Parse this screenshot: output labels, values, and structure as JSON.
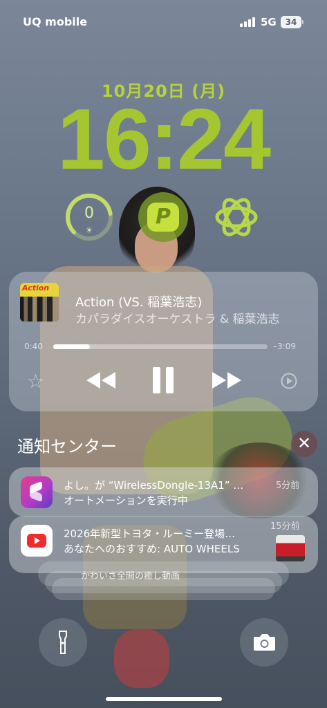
{
  "status_bar": {
    "carrier": "UQ mobile",
    "network": "5G",
    "battery": "34"
  },
  "lock": {
    "date": "10月20日 (月)",
    "time": "16:24"
  },
  "widgets": {
    "ring_value": "0",
    "ring_level": 0.8,
    "sun_icon": "☀",
    "paypay_glyph": "P"
  },
  "now_playing": {
    "title": "Action (VS. 稲葉浩志)",
    "artist": "カパラダイスオーケストラ & 稲葉浩志",
    "art_text": "Action",
    "elapsed": "0:40",
    "remaining": "–3:09",
    "progress": 0.17,
    "favorite_icon": "☆"
  },
  "notification_center": {
    "title": "通知センター",
    "close_icon": "✕",
    "notifications": [
      {
        "app": "shortcuts",
        "title": "よし。が “WirelessDongle-13A1” …",
        "body": "オートメーションを実行中",
        "time": "5分前"
      },
      {
        "app": "youtube",
        "title": "2026年新型トヨタ・ルーミー登場…",
        "body": "あなたへのおすすめ: AUTO WHEELS",
        "time": "15分前"
      }
    ],
    "stacked_preview": "かわいさ全開の癒し動画"
  },
  "quick_actions": {
    "left": "flashlight-icon",
    "right": "camera-icon"
  }
}
